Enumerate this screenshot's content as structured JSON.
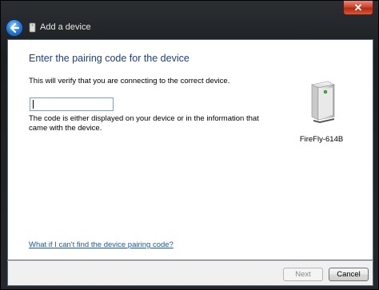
{
  "window": {
    "title": "Add a device",
    "close_glyph": "✕",
    "back_icon": "back-arrow-icon",
    "title_icon": "device-icon"
  },
  "page": {
    "heading": "Enter the pairing code for the device",
    "subtext": "This will verify that you are connecting to the correct device.",
    "code_input": {
      "value": "",
      "placeholder": ""
    },
    "help_text": "The code is either displayed on your device or in the information that came with the device.",
    "device": {
      "name": "FireFly-614B",
      "icon": "wireless-device-icon"
    },
    "help_link": "What if I can't find the device pairing code?"
  },
  "footer": {
    "next_label": "Next",
    "cancel_label": "Cancel"
  },
  "colors": {
    "heading": "#1e3d8a",
    "link": "#1a57b8",
    "close": "#c9472f"
  }
}
